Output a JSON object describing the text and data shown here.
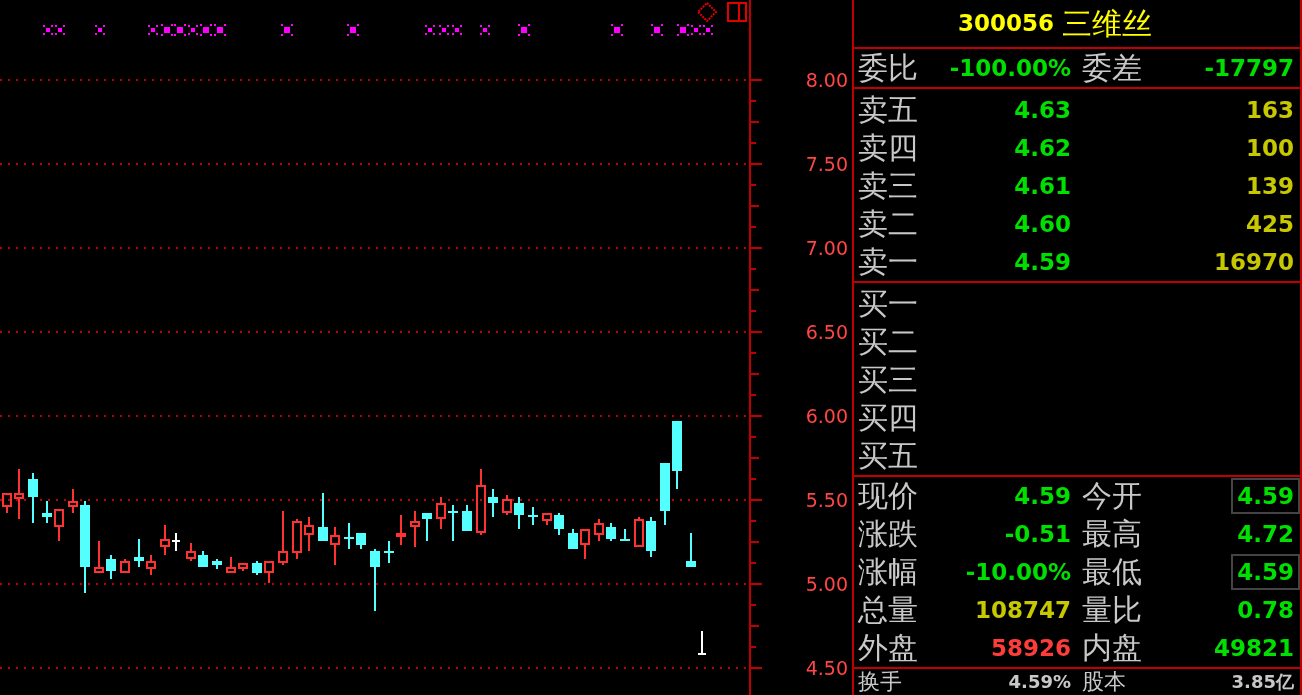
{
  "chart": {
    "price_axis": {
      "labels": [
        "8.00",
        "7.50",
        "7.00",
        "6.50",
        "6.00",
        "5.50",
        "5.00",
        "4.50"
      ]
    }
  },
  "quote_panel": {
    "title": {
      "code": "300056",
      "name": "三维丝"
    },
    "order_ratio": [
      {
        "label": "委比",
        "value": "-100.00%"
      },
      {
        "label": "委差",
        "value": "-17797"
      }
    ],
    "asks": [
      {
        "label": "卖五",
        "price": "4.63",
        "volume": "163"
      },
      {
        "label": "卖四",
        "price": "4.62",
        "volume": "100"
      },
      {
        "label": "卖三",
        "price": "4.61",
        "volume": "139"
      },
      {
        "label": "卖二",
        "price": "4.60",
        "volume": "425"
      },
      {
        "label": "卖一",
        "price": "4.59",
        "volume": "16970"
      }
    ],
    "bids": [
      {
        "label": "买一"
      },
      {
        "label": "买二"
      },
      {
        "label": "买三"
      },
      {
        "label": "买四"
      },
      {
        "label": "买五"
      }
    ],
    "stats": [
      {
        "label": "现价",
        "value": "4.59",
        "color": "#00e000",
        "framed": false
      },
      {
        "label": "今开",
        "value": "4.59",
        "color": "#00e000",
        "framed": true
      },
      {
        "label": "涨跌",
        "value": "-0.51",
        "color": "#00e000",
        "framed": false
      },
      {
        "label": "最高",
        "value": "4.72",
        "color": "#00e000",
        "framed": false
      },
      {
        "label": "涨幅",
        "value": "-10.00%",
        "color": "#00e000",
        "framed": false
      },
      {
        "label": "最低",
        "value": "4.59",
        "color": "#00e000",
        "framed": true
      },
      {
        "label": "总量",
        "value": "108747",
        "color": "#c8c800",
        "framed": false
      },
      {
        "label": "量比",
        "value": "0.78",
        "color": "#00e000",
        "framed": false
      },
      {
        "label": "外盘",
        "value": "58926",
        "color": "#ff3c3c",
        "framed": false
      },
      {
        "label": "内盘",
        "value": "49821",
        "color": "#00e000",
        "framed": false
      }
    ],
    "footer": [
      {
        "label": "换手",
        "value": "4.59%"
      },
      {
        "label": "股本",
        "value": "3.85亿"
      }
    ]
  }
}
